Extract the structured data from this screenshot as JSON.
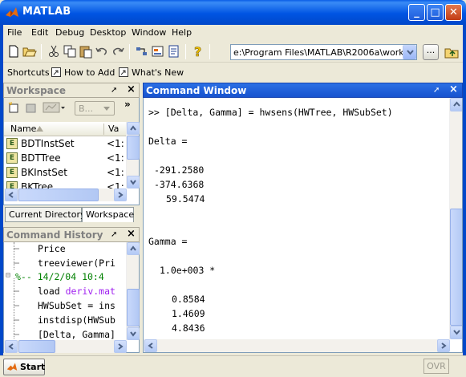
{
  "window": {
    "title": "MATLAB"
  },
  "menu": [
    "File",
    "Edit",
    "Debug",
    "Desktop",
    "Window",
    "Help"
  ],
  "toolbar": {
    "icons": [
      "new-file-icon",
      "open-folder-icon",
      "cut-icon",
      "copy-icon",
      "paste-icon",
      "undo-icon",
      "redo-icon",
      "simulink-icon",
      "guide-icon",
      "profiler-icon",
      "help-icon"
    ],
    "current_directory": "e:\\Program Files\\MATLAB\\R2006a\\work",
    "browse_label": "..."
  },
  "shortcuts": {
    "label": "Shortcuts",
    "items": [
      "How to Add",
      "What's New"
    ]
  },
  "workspace": {
    "title": "Workspace",
    "dropdown_value": "B...",
    "columns": [
      "Name",
      "Va"
    ],
    "rows": [
      {
        "name": "BDTInstSet",
        "value": "<1:"
      },
      {
        "name": "BDTTree",
        "value": "<1:"
      },
      {
        "name": "BKInstSet",
        "value": "<1:"
      },
      {
        "name": "BKTree",
        "value": "<1:"
      }
    ],
    "tabs": [
      "Current Directory",
      "Workspace"
    ]
  },
  "history": {
    "title": "Command History",
    "lines": [
      "Price",
      "treeviewer(Pri",
      "%-- 14/2/04 10:4",
      "load deriv.mat",
      "HWSubSet = ins",
      "instdisp(HWSub",
      "[Delta, Gamma]"
    ]
  },
  "command_window": {
    "title": "Command Window",
    "lines": [
      ">> [Delta, Gamma] = hwsens(HWTree, HWSubSet)",
      "Delta =",
      "-291.2580",
      "-374.6368",
      "59.5474",
      "Gamma =",
      "1.0e+003 *",
      "0.8584",
      "1.4609",
      "4.8436"
    ]
  },
  "taskbar": {
    "start_label": "Start",
    "status": "OVR"
  },
  "colors": {
    "titlebar": "#0054e3",
    "command_title": "#2b6fe4",
    "history_date": "#008000",
    "history_string": "#a020f0"
  }
}
